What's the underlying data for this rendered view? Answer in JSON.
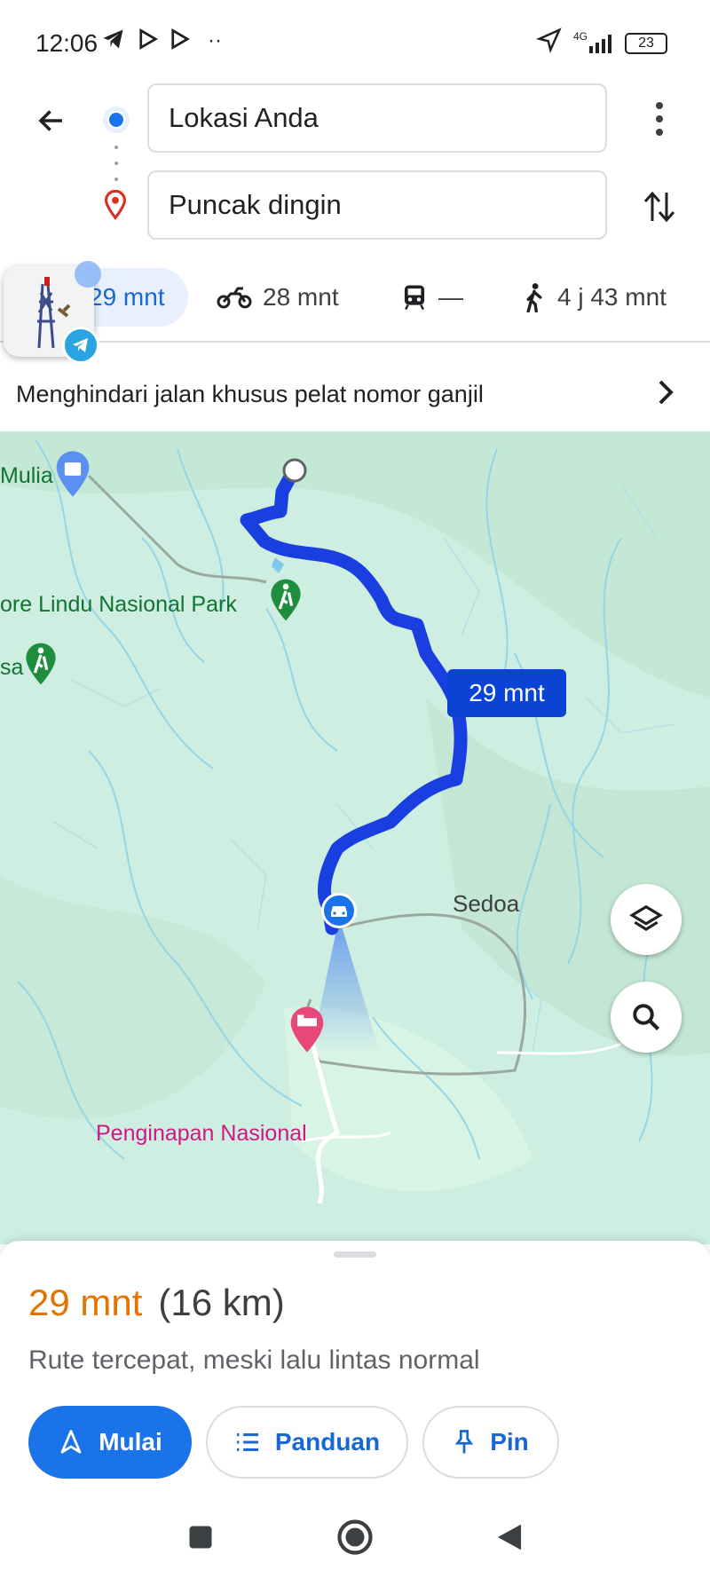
{
  "status_bar": {
    "time": "12:06",
    "network": "4G",
    "battery": "23"
  },
  "search": {
    "origin": "Lokasi Anda",
    "destination": "Puncak dingin"
  },
  "modes": {
    "car": "29 mnt",
    "motorcycle": "28 mnt",
    "transit": "—",
    "walk": "4 j 43 mnt"
  },
  "avoid_notice": "Menghindari jalan khusus pelat nomor ganjil",
  "map": {
    "labels": {
      "park": "ore Lindu Nasional Park",
      "mulia": "Mulia",
      "sa": "sa",
      "sedoa": "Sedoa",
      "penginapan": "Penginapan Nasional"
    },
    "route_time": "29 mnt",
    "colors": {
      "route": "#1a3fe0",
      "terrain": "#cdeee0",
      "poi_park": "#1e8e3e",
      "poi_hotel": "#e8477a"
    }
  },
  "sheet": {
    "eta": "29 mnt",
    "distance": "(16 km)",
    "description": "Rute tercepat, meski lalu lintas normal",
    "start_label": "Mulai",
    "guide_label": "Panduan",
    "pin_label": "Pin"
  },
  "icons": [
    "back-arrow-icon",
    "more-vert-icon",
    "swap-icon",
    "car-icon",
    "motorcycle-icon",
    "transit-icon",
    "walk-icon",
    "layers-icon",
    "search-icon",
    "my-location-icon",
    "navigate-icon",
    "list-icon",
    "pin-icon"
  ]
}
